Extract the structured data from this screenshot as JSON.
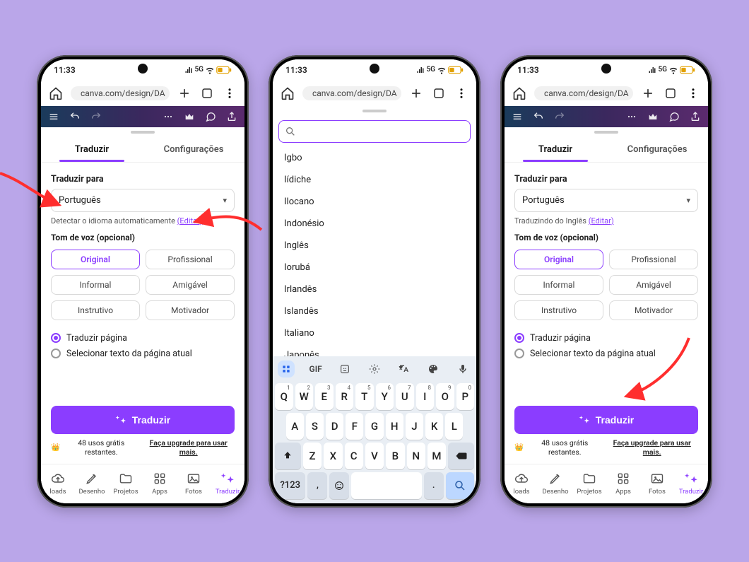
{
  "status": {
    "time": "11:33",
    "network": "5G"
  },
  "browser": {
    "url_display": "canva.com/design/DA"
  },
  "sheet_tabs": {
    "translate": "Traduzir",
    "settings": "Configurações"
  },
  "translate_panel": {
    "to_label": "Traduzir para",
    "language_selected": "Português",
    "detect_text": "Detectar o idioma automaticamente",
    "edit_link": "(Editar)",
    "from_english_text": "Traduzindo do Inglês",
    "tone_label": "Tom de voz (opcional)",
    "tones": {
      "original": "Original",
      "profissional": "Profissional",
      "informal": "Informal",
      "amigavel": "Amigável",
      "instrutivo": "Instrutivo",
      "motivador": "Motivador"
    },
    "radio_page": "Traduzir página",
    "radio_select_text": "Selecionar texto da página atual",
    "button_label": "Traduzir",
    "usage_text": "48 usos grátis restantes.",
    "upgrade_text": "Faça upgrade para usar mais."
  },
  "bottom_nav": {
    "items": [
      {
        "k": "loads",
        "label": "loads"
      },
      {
        "k": "desenho",
        "label": "Desenho"
      },
      {
        "k": "projetos",
        "label": "Projetos"
      },
      {
        "k": "apps",
        "label": "Apps"
      },
      {
        "k": "fotos",
        "label": "Fotos"
      },
      {
        "k": "traduzir",
        "label": "Traduzir"
      }
    ]
  },
  "language_list": [
    "Igbo",
    "Iídiche",
    "Ilocano",
    "Indonésio",
    "Inglês",
    "Iorubá",
    "Irlandês",
    "Islandês",
    "Italiano",
    "Japonês"
  ],
  "keyboard": {
    "gif": "GIF",
    "rows": [
      [
        "Q",
        "W",
        "E",
        "R",
        "T",
        "Y",
        "U",
        "I",
        "O",
        "P"
      ],
      [
        "A",
        "S",
        "D",
        "F",
        "G",
        "H",
        "J",
        "K",
        "L"
      ],
      [
        "Z",
        "X",
        "C",
        "V",
        "B",
        "N",
        "M"
      ]
    ],
    "digits": [
      "1",
      "2",
      "3",
      "4",
      "5",
      "6",
      "7",
      "8",
      "9",
      "0"
    ],
    "symbols": "?123",
    "comma": ",",
    "period": "."
  }
}
